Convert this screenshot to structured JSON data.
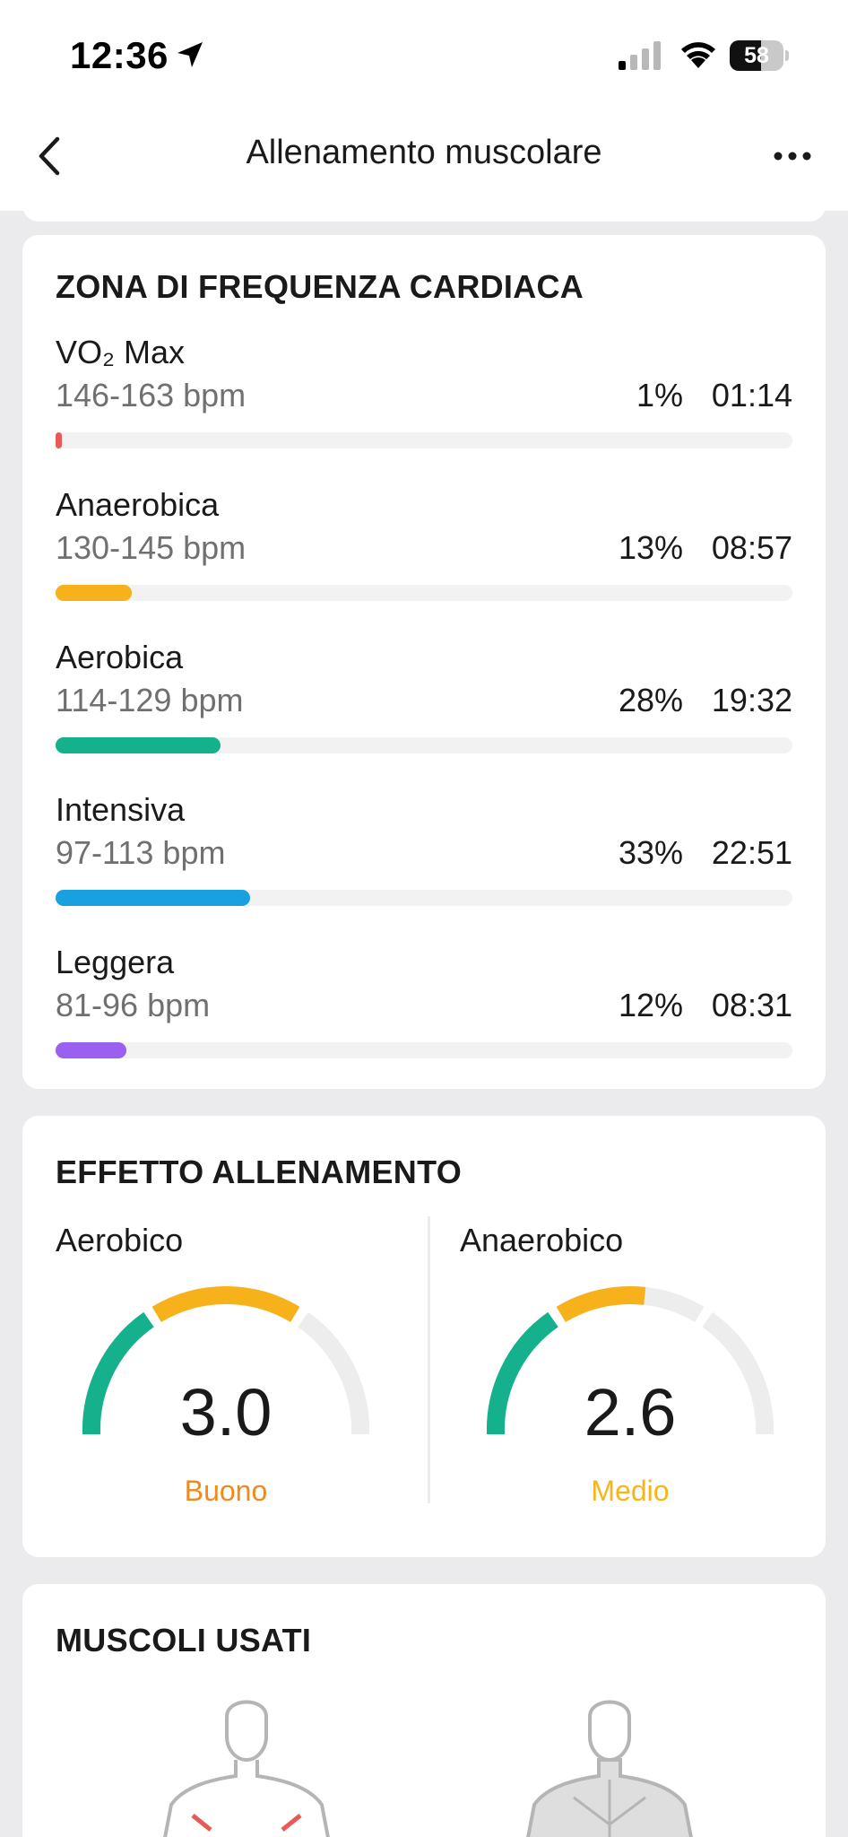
{
  "status_bar": {
    "time": "12:36",
    "battery": "58"
  },
  "nav": {
    "title": "Allenamento muscolare"
  },
  "heart_rate": {
    "title": "ZONA DI FREQUENZA CARDIACA",
    "zones": [
      {
        "name": "VO₂ Max",
        "range": "146-163 bpm",
        "percent": "1%",
        "time": "01:14",
        "fraction": 0.01,
        "color": "#e85a55"
      },
      {
        "name": "Anaerobica",
        "range": "130-145 bpm",
        "percent": "13%",
        "time": "08:57",
        "fraction": 0.13,
        "color": "#f7b21b"
      },
      {
        "name": "Aerobica",
        "range": "114-129 bpm",
        "percent": "28%",
        "time": "19:32",
        "fraction": 0.28,
        "color": "#15b08c"
      },
      {
        "name": "Intensiva",
        "range": "97-113 bpm",
        "percent": "33%",
        "time": "22:51",
        "fraction": 0.33,
        "color": "#18a0e0"
      },
      {
        "name": "Leggera",
        "range": "81-96 bpm",
        "percent": "12%",
        "time": "08:31",
        "fraction": 0.12,
        "color": "#9a61f0"
      }
    ]
  },
  "training_effect": {
    "title": "EFFETTO ALLENAMENTO",
    "aerobic": {
      "label": "Aerobico",
      "value": "3.0",
      "rating": "Buono",
      "rating_color": "#ee8a1e"
    },
    "anaerobic": {
      "label": "Anaerobico",
      "value": "2.6",
      "rating": "Medio",
      "rating_color": "#f6b51c"
    }
  },
  "muscles": {
    "title": "MUSCOLI USATI"
  }
}
